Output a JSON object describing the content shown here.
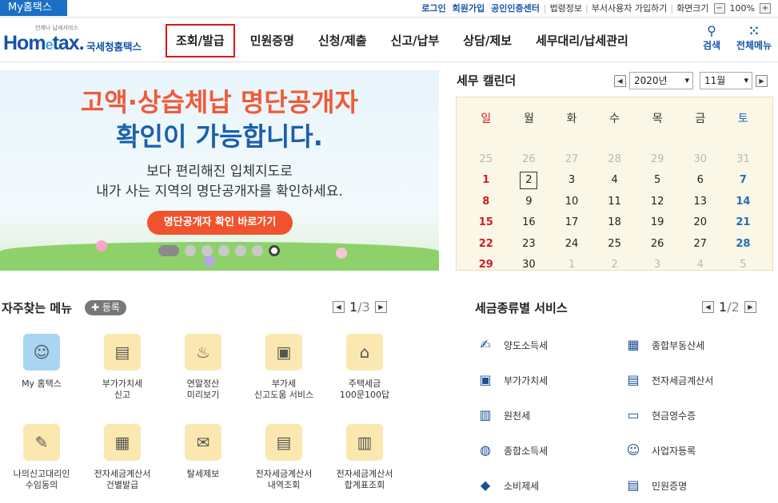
{
  "topbar": {
    "my_tab": "My홈택스",
    "links": [
      "로그인",
      "회원가입",
      "공인인증센터"
    ],
    "plain_links": [
      "법령정보",
      "부서사용자 가입하기",
      "화면크기"
    ],
    "zoom_minus": "−",
    "zoom_value": "100%",
    "zoom_plus": "+"
  },
  "header": {
    "logo_small": "언제나 납세서비스",
    "logo_home": "Hom",
    "logo_e": "e",
    "logo_tax": "tax.",
    "logo_kor": "국세청홈택스",
    "nav": [
      "조회/발급",
      "민원증명",
      "신청/제출",
      "신고/납부",
      "상담/제보",
      "세무대리/납세관리"
    ],
    "search_label": "검색",
    "menu_label": "전체메뉴",
    "icons": {
      "search": "search-icon",
      "menu": "grid-icon"
    }
  },
  "banner": {
    "line1": "고액·상습체납 명단공개자",
    "line2": "확인이 가능합니다.",
    "line3": "보다 편리해진 입체지도로",
    "line4": "내가 사는 지역의 명단공개자를 확인하세요.",
    "button": "명단공개자 확인 바로가기",
    "slide_count": 7,
    "active_slide": 1
  },
  "calendar": {
    "title": "세무 캘린더",
    "year": "2020년",
    "month": "11월",
    "weekdays": [
      "일",
      "월",
      "화",
      "수",
      "목",
      "금",
      "토"
    ],
    "weeks": [
      [
        "25",
        "26",
        "27",
        "28",
        "29",
        "30",
        "31"
      ],
      [
        "1",
        "2",
        "3",
        "4",
        "5",
        "6",
        "7"
      ],
      [
        "8",
        "9",
        "10",
        "11",
        "12",
        "13",
        "14"
      ],
      [
        "15",
        "16",
        "17",
        "18",
        "19",
        "20",
        "21"
      ],
      [
        "22",
        "23",
        "24",
        "25",
        "26",
        "27",
        "28"
      ],
      [
        "29",
        "30",
        "1",
        "2",
        "3",
        "4",
        "5"
      ]
    ],
    "today": "2"
  },
  "favorites": {
    "title": "자주찾는 메뉴",
    "register": "✚ 등록",
    "page": "1",
    "total": "/3",
    "items": [
      {
        "l1": "My 홈택스",
        "l2": ""
      },
      {
        "l1": "부가가치세",
        "l2": "신고"
      },
      {
        "l1": "연말정산",
        "l2": "미리보기"
      },
      {
        "l1": "부가세",
        "l2": "신고도움 서비스"
      },
      {
        "l1": "주택세금",
        "l2": "100문100답"
      },
      {
        "l1": "나의신고대리인",
        "l2": "수임동의"
      },
      {
        "l1": "전자세금계산서",
        "l2": "건별발급"
      },
      {
        "l1": "탈세제보",
        "l2": ""
      },
      {
        "l1": "전자세금계산서",
        "l2": "내역조회"
      },
      {
        "l1": "전자세금계산서",
        "l2": "합계표조회"
      }
    ]
  },
  "taxservice": {
    "title": "세금종류별 서비스",
    "page": "1",
    "total": "/2",
    "items": [
      "양도소득세",
      "종합부동산세",
      "부가가치세",
      "전자세금계산서",
      "원천세",
      "현금영수증",
      "종합소득세",
      "사업자등록",
      "소비제세",
      "민원증명"
    ]
  }
}
